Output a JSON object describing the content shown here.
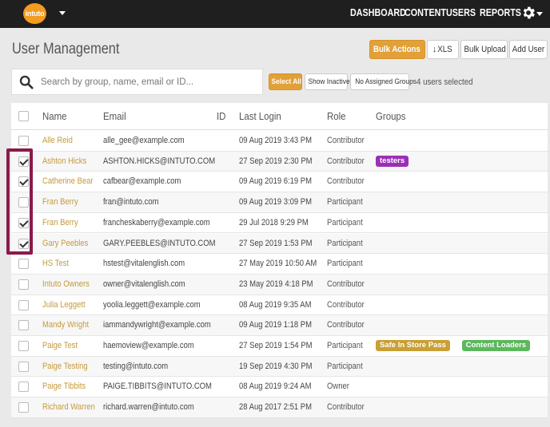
{
  "nav": {
    "logo_text": "intuto",
    "items": [
      "DASHBOARD",
      "CONTENT",
      "USERS",
      "REPORTS"
    ]
  },
  "header": {
    "title": "User Management",
    "bulk_actions": "Bulk Actions",
    "xls": "XLS",
    "bulk_upload": "Bulk Upload",
    "add_user": "Add User"
  },
  "search": {
    "placeholder": "Search by group, name, email or ID..."
  },
  "filters": {
    "select_all": "Select All",
    "show_inactive": "Show Inactive",
    "no_assigned_groups": "No Assigned Groups",
    "selected_count": "4 users selected"
  },
  "table": {
    "columns": [
      "Name",
      "Email",
      "ID",
      "Last Login",
      "Role",
      "Groups"
    ],
    "rows": [
      {
        "checked": false,
        "name": "Alle Reid",
        "email": "alle_gee@example.com",
        "id": "",
        "last_login": "09 Aug 2019 3:43 PM",
        "role": "Contributor",
        "groups": []
      },
      {
        "checked": true,
        "name": "Ashton Hicks",
        "email": "ASHTON.HICKS@INTUTO.COM",
        "id": "",
        "last_login": "27 Sep 2019 2:30 PM",
        "role": "Contributor",
        "groups": [
          {
            "label": "testers",
            "color": "#9b2fb8"
          }
        ]
      },
      {
        "checked": true,
        "name": "Catherine Bear",
        "email": "cafbear@example.com",
        "id": "",
        "last_login": "09 Aug 2019 6:19 PM",
        "role": "Contributor",
        "groups": []
      },
      {
        "checked": false,
        "name": "Fran Berry",
        "email": "fran@intuto.com",
        "id": "",
        "last_login": "09 Aug 2019 3:09 PM",
        "role": "Participant",
        "groups": []
      },
      {
        "checked": true,
        "name": "Fran Berry",
        "email": "francheskaberry@example.com",
        "id": "",
        "last_login": "29 Jul 2018 9:29 PM",
        "role": "Participant",
        "groups": []
      },
      {
        "checked": true,
        "name": "Gary Peebles",
        "email": "GARY.PEEBLES@INTUTO.COM",
        "id": "",
        "last_login": "27 Sep 2019 1:53 PM",
        "role": "Participant",
        "groups": []
      },
      {
        "checked": false,
        "name": "HS Test",
        "email": "hstest@vitalenglish.com",
        "id": "",
        "last_login": "27 May 2019 10:50 AM",
        "role": "Participant",
        "groups": []
      },
      {
        "checked": false,
        "name": "Intuto Owners",
        "email": "owner@vitalenglish.com",
        "id": "",
        "last_login": "23 May 2019 4:18 PM",
        "role": "Contributor",
        "groups": []
      },
      {
        "checked": false,
        "name": "Julia Leggett",
        "email": "yoolia.leggett@example.com",
        "id": "",
        "last_login": "08 Aug 2019 9:35 AM",
        "role": "Contributor",
        "groups": []
      },
      {
        "checked": false,
        "name": "Mandy Wright",
        "email": "iammandywright@example.com",
        "id": "",
        "last_login": "09 Aug 2019 1:18 PM",
        "role": "Contributor",
        "groups": []
      },
      {
        "checked": false,
        "name": "Paige Test",
        "email": "haemoview@example.com",
        "id": "",
        "last_login": "27 Sep 2019 1:54 PM",
        "role": "Participant",
        "groups": [
          {
            "label": "Safe In Store Pass",
            "color": "#c9a035"
          },
          {
            "label": "Content Loaders",
            "color": "#5cb85c"
          }
        ]
      },
      {
        "checked": false,
        "name": "Paige Testing",
        "email": "testing@intuto.com",
        "id": "",
        "last_login": "19 Sep 2019 4:30 PM",
        "role": "Participant",
        "groups": []
      },
      {
        "checked": false,
        "name": "Paige Tibbits",
        "email": "PAIGE.TIBBITS@INTUTO.COM",
        "id": "",
        "last_login": "08 Aug 2019 9:24 AM",
        "role": "Owner",
        "groups": []
      },
      {
        "checked": false,
        "name": "Richard Warren",
        "email": "richard.warren@intuto.com",
        "id": "",
        "last_login": "28 Aug 2017 2:51 PM",
        "role": "Contributor",
        "groups": []
      }
    ]
  }
}
